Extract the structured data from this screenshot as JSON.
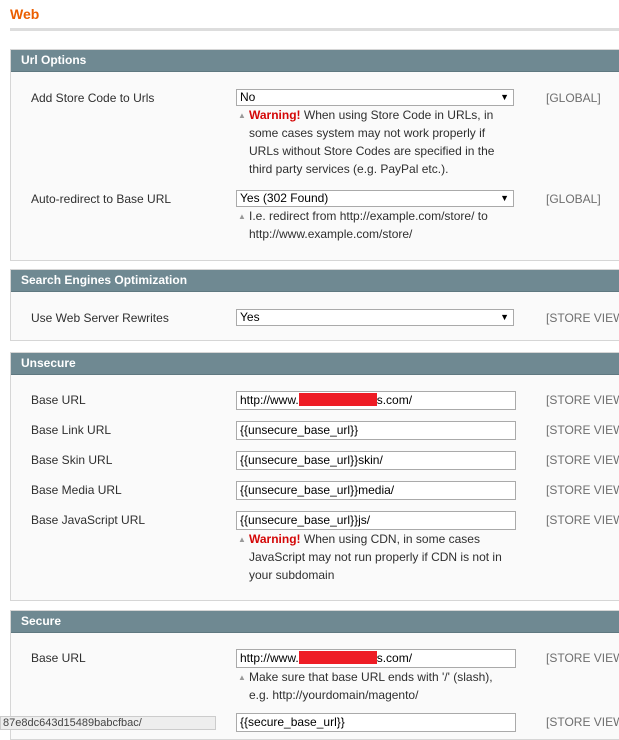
{
  "page": {
    "title": "Web"
  },
  "url_options": {
    "title": "Url Options",
    "add_store_code": {
      "label": "Add Store Code to Urls",
      "value": "No",
      "warning_label": "Warning!",
      "note_lines": [
        " When using Store Code in URLs, in",
        "some cases system may not work properly if",
        "URLs without Store Codes are specified in the",
        "third party services (e.g. PayPal etc.)."
      ],
      "scope": "[GLOBAL]"
    },
    "auto_redirect": {
      "label": "Auto-redirect to Base URL",
      "value": "Yes (302 Found)",
      "note_lines": [
        "I.e. redirect from http://example.com/store/ to",
        "http://www.example.com/store/"
      ],
      "scope": "[GLOBAL]"
    }
  },
  "seo": {
    "title": "Search Engines Optimization",
    "rewrites": {
      "label": "Use Web Server Rewrites",
      "value": "Yes",
      "scope": "[STORE VIEW"
    }
  },
  "unsecure": {
    "title": "Unsecure",
    "base_url": {
      "label": "Base URL",
      "prefix": "http://www.",
      "suffix": "s.com/",
      "scope": "[STORE VIEW"
    },
    "base_link_url": {
      "label": "Base Link URL",
      "value": "{{unsecure_base_url}}",
      "scope": "[STORE VIEW"
    },
    "base_skin_url": {
      "label": "Base Skin URL",
      "value": "{{unsecure_base_url}}skin/",
      "scope": "[STORE VIEW"
    },
    "base_media_url": {
      "label": "Base Media URL",
      "value": "{{unsecure_base_url}}media/",
      "scope": "[STORE VIEW"
    },
    "base_js_url": {
      "label": "Base JavaScript URL",
      "value": "{{unsecure_base_url}}js/",
      "warning_label": "Warning!",
      "note_lines": [
        " When using CDN, in some cases",
        "JavaScript may not run properly if CDN is not in",
        "your subdomain"
      ],
      "scope": "[STORE VIEW"
    }
  },
  "secure": {
    "title": "Secure",
    "base_url": {
      "label": "Base URL",
      "prefix": "http://www.",
      "suffix": "s.com/",
      "note_lines": [
        "Make sure that base URL ends with '/' (slash),",
        "e.g. http://yourdomain/magento/"
      ],
      "scope": "[STORE VIEW"
    },
    "base_link_url": {
      "value": "{{secure_base_url}}",
      "scope": "[STORE VIEW"
    }
  },
  "statusbar": {
    "text": "87e8dc643d15489babcfbac/"
  }
}
